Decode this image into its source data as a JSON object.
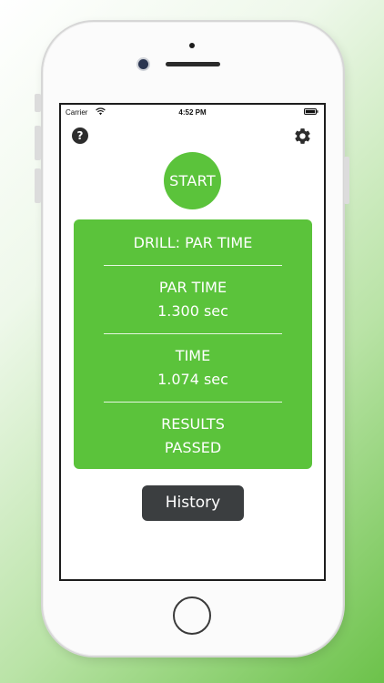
{
  "status_bar": {
    "carrier": "Carrier",
    "time": "4:52 PM",
    "wifi_icon": "wifi-icon",
    "battery_icon": "battery-icon"
  },
  "toolbar": {
    "help_label": "?",
    "help_icon": "question-circle-icon",
    "settings_icon": "gear-icon"
  },
  "start_button": {
    "label": "START",
    "color": "#5bc33b"
  },
  "card": {
    "color": "#5bc33b",
    "drill": "DRILL: PAR TIME",
    "par_time_label": "PAR TIME",
    "par_time_value": "1.300 sec",
    "time_label": "TIME",
    "time_value": "1.074 sec",
    "results_label": "RESULTS",
    "results_value": "PASSED"
  },
  "history_button": {
    "label": "History",
    "color": "#3b3e40"
  }
}
